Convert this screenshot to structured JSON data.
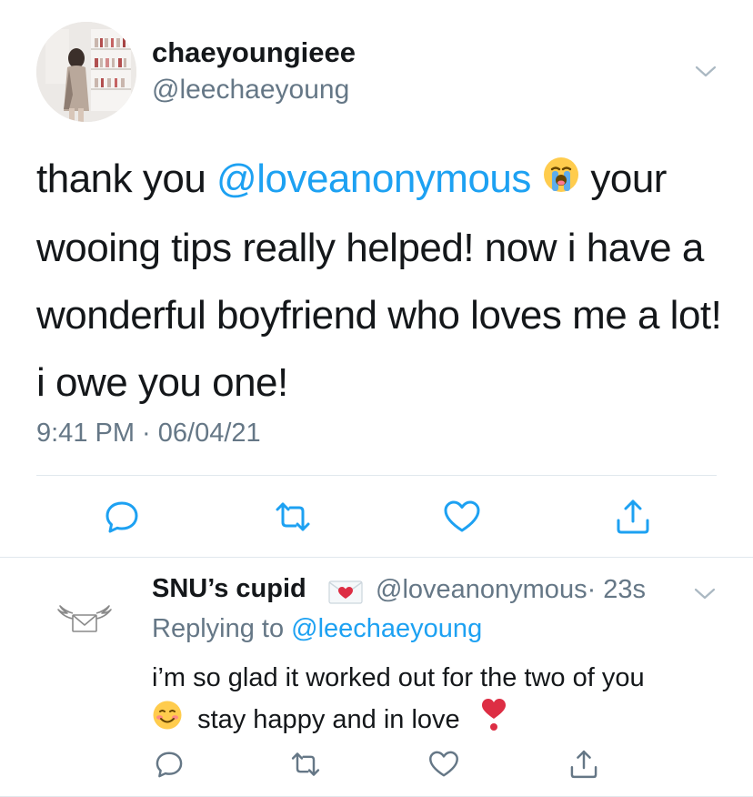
{
  "tweet": {
    "avatar_icon": "profile-photo-avatar",
    "display_name": "chaeyoungieee",
    "handle": "@leechaeyoung",
    "text_part1": "thank you ",
    "mention": "@loveanonymous",
    "emoji1_icon": "loudly-crying-face-emoji",
    "text_part2": " your wooing tips really helped! now i have a wonderful boyfriend who loves me a lot! i owe you one!",
    "timestamp": "9:41 PM · 06/04/21",
    "actions": [
      "reply-icon",
      "retweet-icon",
      "like-icon",
      "share-icon"
    ]
  },
  "reply": {
    "avatar_icon": "winged-envelope-avatar",
    "display_name": "SNU’s cupid",
    "badge_icon": "love-letter-emoji",
    "handle": "@loveanonymous",
    "time": "· 23s",
    "replying_prefix": "Replying to ",
    "replying_handle": "@leechaeyoung",
    "text_line1": "i’m so glad it worked out for the two of you",
    "text_line2": "stay happy and in love",
    "emoji_smile_icon": "smiling-face-emoji",
    "emoji_heart_icon": "heart-exclamation-emoji",
    "actions": [
      "reply-icon",
      "retweet-icon",
      "like-icon",
      "share-icon"
    ]
  },
  "colors": {
    "accent": "#1da1f2",
    "secondary_text": "#657786",
    "primary_text": "#14171a",
    "divider": "#e1e8ed"
  }
}
